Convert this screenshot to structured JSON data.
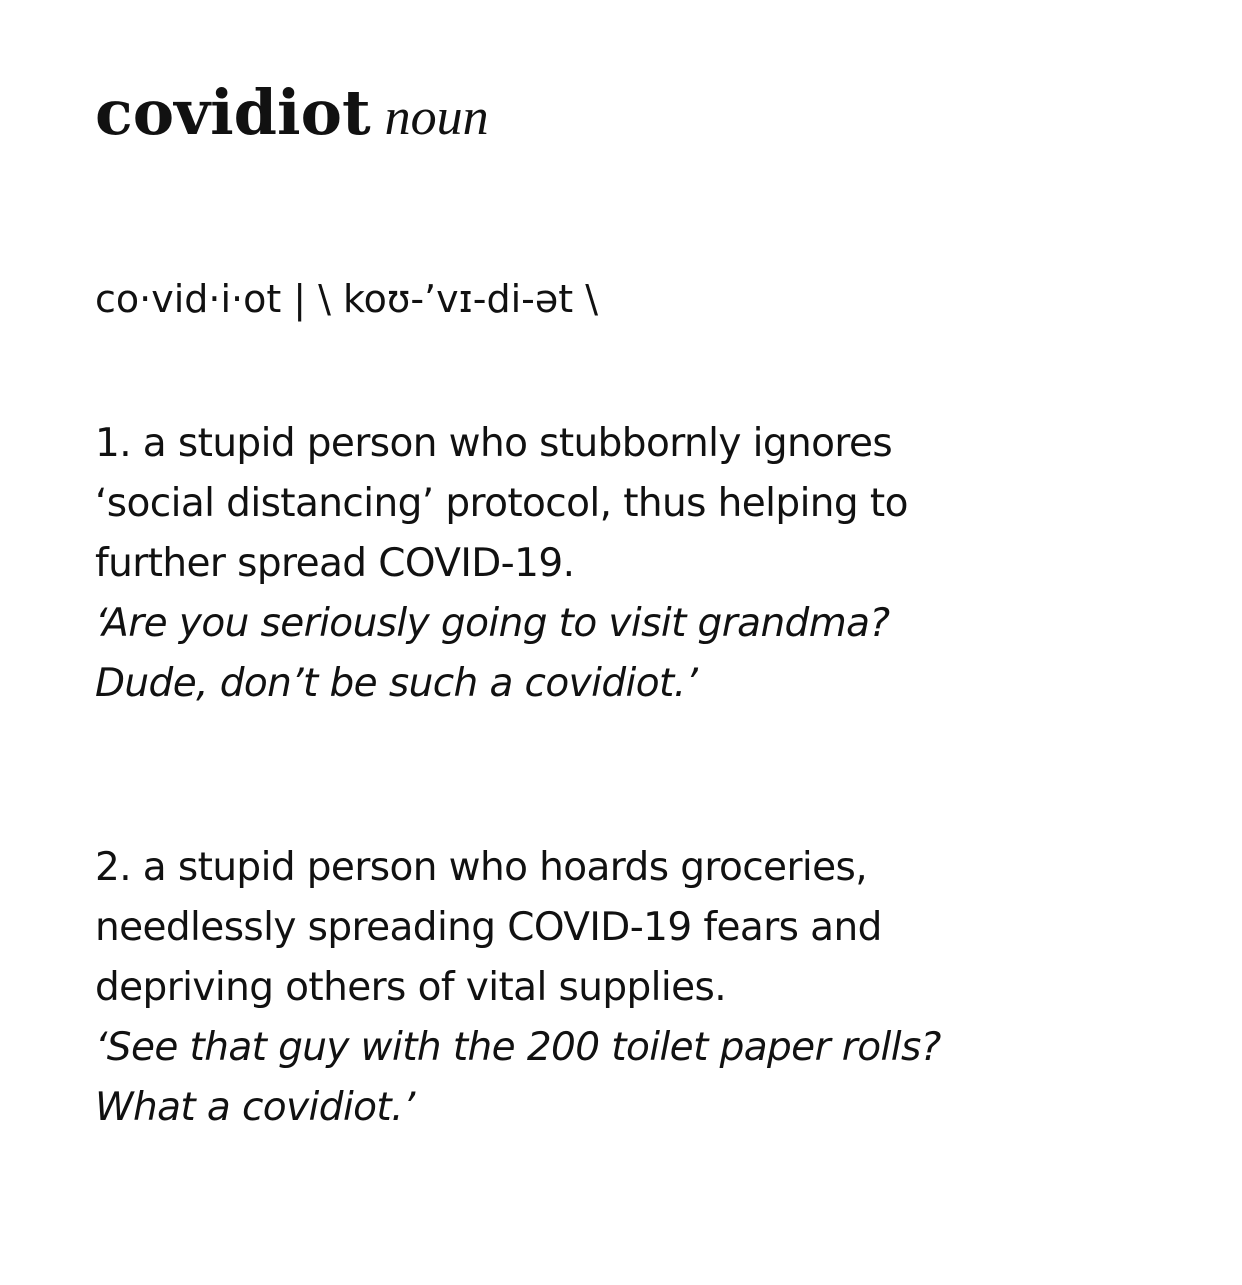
{
  "entry": {
    "headword": "covidiot",
    "part_of_speech": "noun",
    "syllabification": "co·vid·i·ot",
    "separator": "|",
    "pronunciation": "\\ koʊ-’vɪ-di-ət \\"
  },
  "senses": [
    {
      "definition_lines": [
        "1. a stupid person who stubbornly ignores",
        "‘social distancing’ protocol, thus helping to",
        "further spread COVID-19."
      ],
      "example_lines": [
        "‘Are you seriously going to visit grandma?",
        "Dude, don’t be such a covidiot.’"
      ]
    },
    {
      "definition_lines": [
        "2. a stupid person who hoards groceries,",
        "needlessly spreading COVID-19 fears and",
        "depriving others of vital supplies."
      ],
      "example_lines": [
        "‘See that guy with the 200 toilet paper rolls?",
        "What a covidiot.’"
      ]
    }
  ]
}
